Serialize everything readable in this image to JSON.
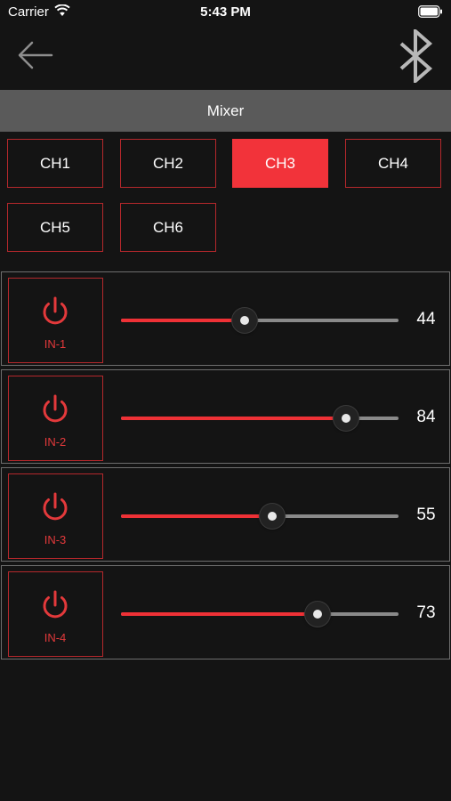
{
  "status_bar": {
    "carrier": "Carrier",
    "time": "5:43 PM"
  },
  "nav": {
    "back_icon": "arrow-left-icon",
    "bluetooth_icon": "bluetooth-icon"
  },
  "title": "Mixer",
  "channels": [
    {
      "label": "CH1",
      "selected": false
    },
    {
      "label": "CH2",
      "selected": false
    },
    {
      "label": "CH3",
      "selected": true
    },
    {
      "label": "CH4",
      "selected": false
    },
    {
      "label": "CH5",
      "selected": false
    },
    {
      "label": "CH6",
      "selected": false
    }
  ],
  "strips": [
    {
      "label": "IN-1",
      "value": "44",
      "level": 0.44
    },
    {
      "label": "IN-2",
      "value": "84",
      "level": 0.84
    },
    {
      "label": "IN-3",
      "value": "55",
      "level": 0.55
    },
    {
      "label": "IN-4",
      "value": "73",
      "level": 0.73
    }
  ],
  "colors": {
    "accent": "#f2333a",
    "border_red": "#b5282c",
    "background": "#141414",
    "title_bar": "#5a5a5a"
  }
}
